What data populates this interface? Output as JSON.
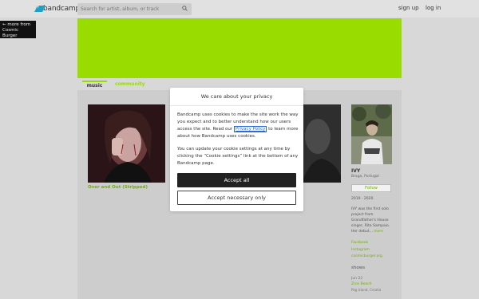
{
  "header": {
    "logo_text": "bandcamp",
    "search_placeholder": "Search for artist, album, or track",
    "signup_label": "sign up",
    "login_label": "log in"
  },
  "back_link": {
    "line1": "← more from",
    "line2": "Cosmic Burger"
  },
  "colors": {
    "banner": "#99dd00",
    "accent_link": "#6fb000",
    "topbar": "#e1e1e1"
  },
  "tabs": [
    {
      "label": "music"
    },
    {
      "label": "community"
    }
  ],
  "album": {
    "title": "Over and Out (Stripped)"
  },
  "artist": {
    "name": "IVY",
    "location": "Braga, Portugal",
    "follow_label": "Follow",
    "years": "2019 - 2020.",
    "bio": "IVY was the first solo project from Grandfather's House singer, Rita Sampaio. Her debut...",
    "more_label": "more",
    "links": [
      "Facebook",
      "Instagram",
      "cosmicburger.org"
    ],
    "shows_heading": "shows",
    "show": {
      "date": "Jun 22",
      "venue": "Zrce Beach",
      "place": "Pag Island, Croatia"
    }
  },
  "cookie_modal": {
    "title": "We care about your privacy",
    "p1_a": "Bandcamp uses cookies to make the site work the way you expect and to better understand how our users access the site. Read our ",
    "policy_link": "Privacy Policy",
    "p1_b": " to learn more about how Bandcamp uses cookies.",
    "p2": "You can update your cookie settings at any time by clicking the “Cookie settings” link at the bottom of any Bandcamp page.",
    "accept_all": "Accept all",
    "accept_necessary": "Accept necessary only"
  }
}
